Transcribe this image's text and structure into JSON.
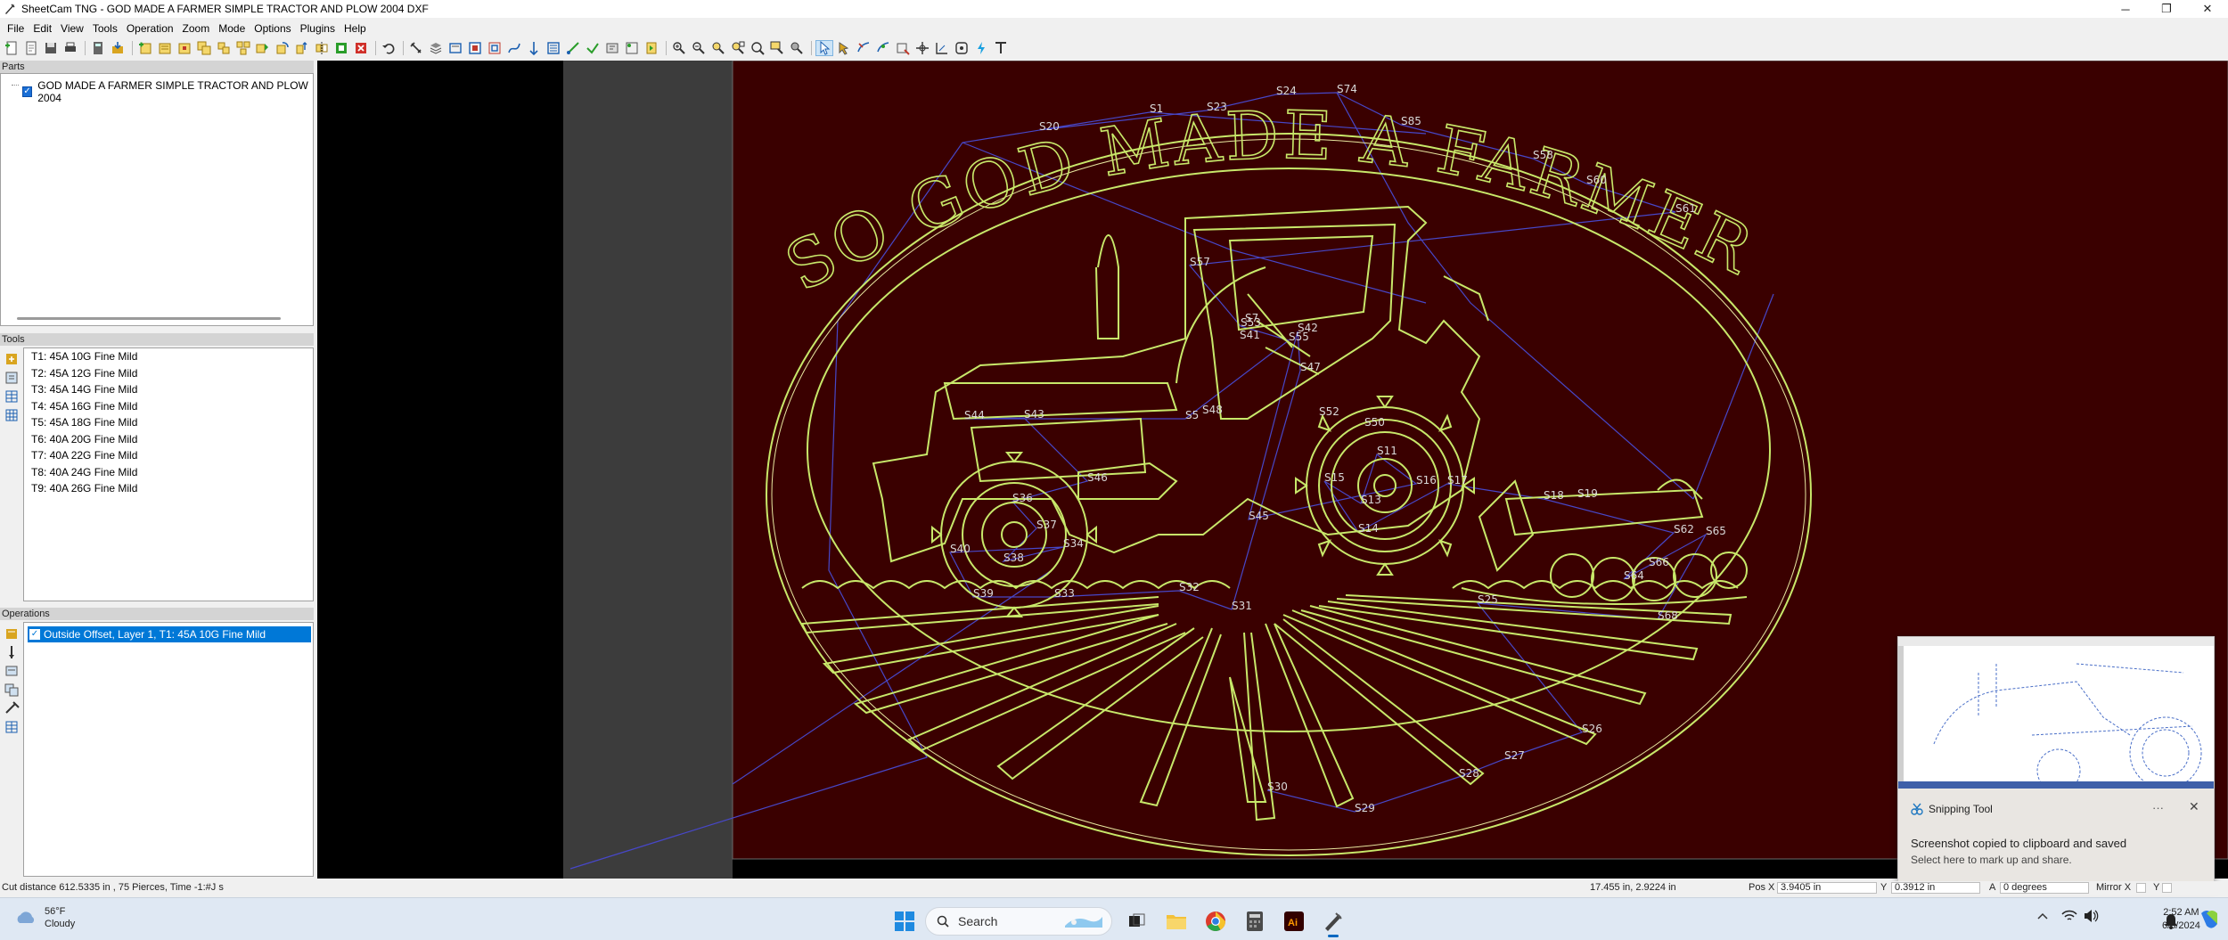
{
  "window": {
    "title": "SheetCam TNG - GOD MADE A FARMER SIMPLE TRACTOR AND PLOW 2004 DXF",
    "minimize_glyph": "─",
    "maximize_glyph": "❐",
    "close_glyph": "✕"
  },
  "menu": [
    "File",
    "Edit",
    "View",
    "Tools",
    "Operation",
    "Zoom",
    "Mode",
    "Options",
    "Plugins",
    "Help"
  ],
  "panels": {
    "parts": {
      "header": "Parts",
      "items": [
        {
          "label": "GOD MADE A FARMER SIMPLE TRACTOR AND PLOW 2004",
          "checked": true
        }
      ]
    },
    "tools": {
      "header": "Tools",
      "items": [
        "T1: 45A 10G Fine Mild",
        "T2: 45A 12G Fine Mild",
        "T3: 45A 14G Fine Mild",
        "T4: 45A 16G Fine Mild",
        "T5: 45A 18G Fine Mild",
        "T6: 40A 20G Fine Mild",
        "T7: 40A 22G Fine Mild",
        "T8: 40A 24G Fine Mild",
        "T9: 40A 26G Fine Mild"
      ]
    },
    "operations": {
      "header": "Operations",
      "items": [
        {
          "label": "Outside Offset, Layer 1, T1: 45A 10G Fine Mild",
          "checked": true,
          "selected": true
        }
      ]
    }
  },
  "canvas": {
    "background": "#3a0000",
    "part_color": "#c8e86a",
    "rapid_color": "#4747c8",
    "sign_text": "SO GOD MADE A FARMER",
    "start_labels": [
      "S1",
      "S20",
      "S23",
      "S24",
      "S74",
      "S85",
      "S58",
      "S60",
      "S61",
      "S57",
      "S53",
      "S55",
      "S44",
      "S43",
      "S46",
      "S36",
      "S37",
      "S38",
      "S34",
      "S40",
      "S39",
      "S33",
      "S32",
      "S31",
      "S5",
      "S47",
      "S42",
      "S45",
      "S16",
      "S11",
      "S13",
      "S15",
      "S14",
      "S17",
      "S18",
      "S62",
      "S64",
      "S66",
      "S65",
      "S68",
      "S25",
      "S26",
      "S27",
      "S28",
      "S29",
      "S30",
      "S50",
      "S52",
      "S41",
      "S48",
      "S7",
      "S19"
    ]
  },
  "snipping_tool": {
    "app_name": "Snipping Tool",
    "more_glyph": "···",
    "close_glyph": "✕",
    "message": "Screenshot copied to clipboard and saved",
    "sub_message": "Select here to mark up and share."
  },
  "status": {
    "cut_info": "Cut distance 612.5335 in , 75 Pierces, Time -1:#J s",
    "dims": "17.455 in, 2.9224 in",
    "pos_x_label": "Pos X",
    "pos_x_value": "3.9405 in",
    "y_label": "Y",
    "y_value": "0.3912 in",
    "angle_label": "A",
    "angle_value": "0 degrees",
    "mirror_label": "Mirror X",
    "y2_label": "Y"
  },
  "taskbar": {
    "weather_temp": "56°F",
    "weather_cond": "Cloudy",
    "search_label": "Search",
    "time": "2:52 AM",
    "date": "6/8/2024"
  }
}
